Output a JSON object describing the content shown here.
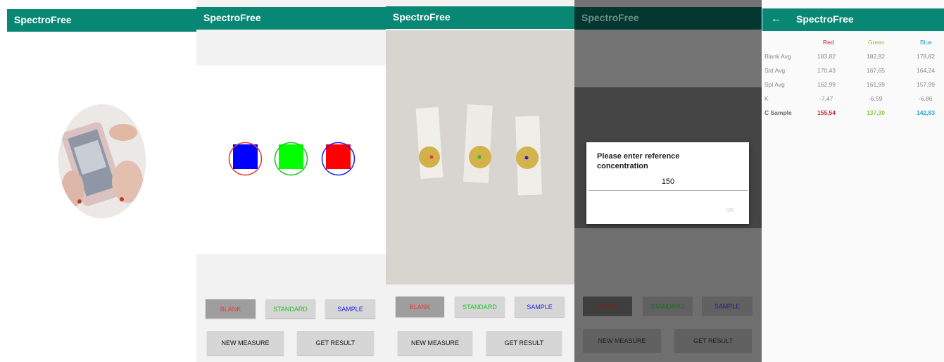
{
  "app": {
    "title": "SpectroFree"
  },
  "buttons": {
    "blank": "BLANK",
    "standard": "STANDARD",
    "sample": "SAMPLE",
    "new_measure": "NEW MEASURE",
    "get_result": "GET RESULT"
  },
  "dialog": {
    "title": "Please enter reference concentration",
    "value": "150",
    "ok": "OK"
  },
  "results": {
    "headers": {
      "red": "Red",
      "green": "Green",
      "blue": "Blue"
    },
    "rows": [
      {
        "label": "Blank Avg",
        "red": "183,82",
        "green": "182,82",
        "blue": "178,82"
      },
      {
        "label": "Std Avg",
        "red": "170,43",
        "green": "167,65",
        "blue": "164,24"
      },
      {
        "label": "Spl Avg",
        "red": "162,99",
        "green": "161,99",
        "blue": "157,99"
      },
      {
        "label": "K",
        "red": "-7,47",
        "green": "-6,59",
        "blue": "-6,86"
      },
      {
        "label": "C Sample",
        "red": "155,54",
        "green": "137,30",
        "blue": "142,83"
      }
    ]
  },
  "colors": {
    "appbar": "#088874",
    "red": "#e53935",
    "green": "#21c121",
    "blue": "#1f1ff0"
  }
}
